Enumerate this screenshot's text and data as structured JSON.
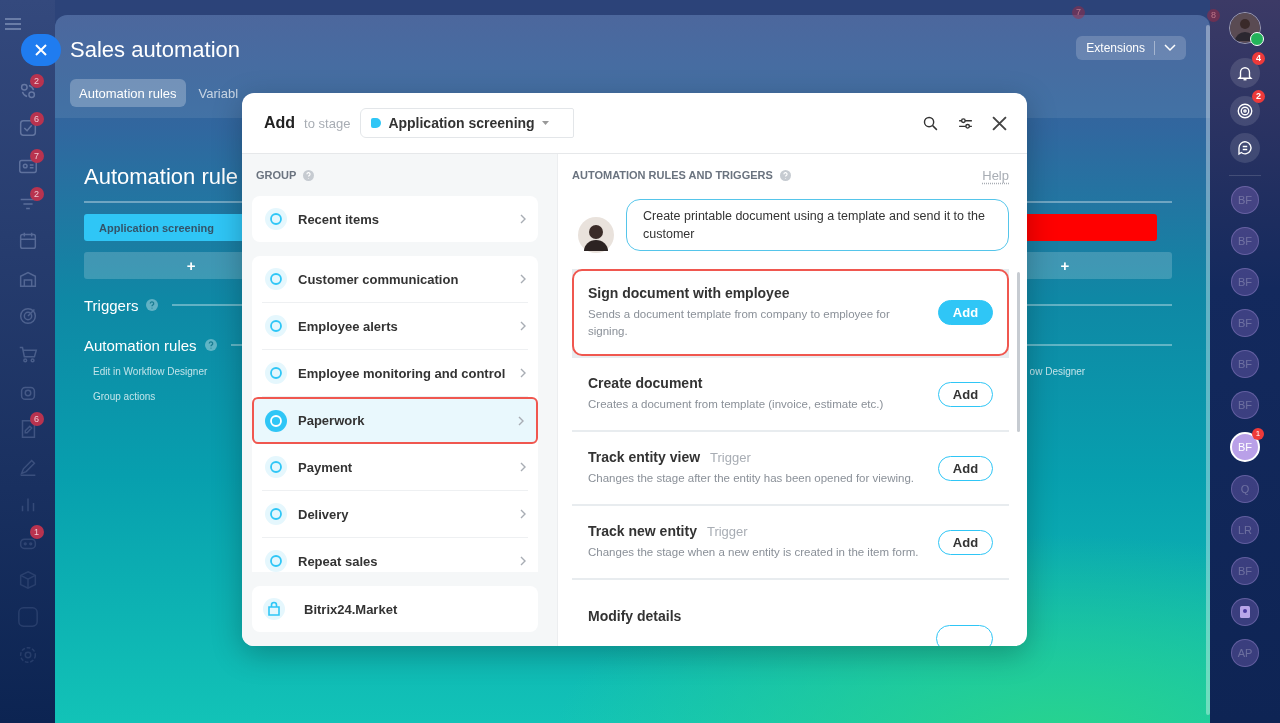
{
  "left_nav": {
    "items": [
      {
        "kind": "menu"
      },
      {
        "kind": "close"
      },
      {
        "kind": "link",
        "badge": "2"
      },
      {
        "kind": "link",
        "badge": "6"
      },
      {
        "kind": "link",
        "badge": "7"
      },
      {
        "kind": "link",
        "badge": "2"
      },
      {
        "kind": "link"
      },
      {
        "kind": "link"
      },
      {
        "kind": "link"
      },
      {
        "kind": "link"
      },
      {
        "kind": "link"
      },
      {
        "kind": "link",
        "badge": "6"
      },
      {
        "kind": "link"
      },
      {
        "kind": "link"
      },
      {
        "kind": "link",
        "badge": "1"
      },
      {
        "kind": "link"
      },
      {
        "kind": "link"
      },
      {
        "kind": "link"
      }
    ]
  },
  "background_badges": [
    "7",
    "8"
  ],
  "slider": {
    "title": "Sales automation",
    "extensions_button": "Extensions",
    "tabs": [
      {
        "label": "Automation rules",
        "selected": true
      },
      {
        "label": "Variabl",
        "selected": false
      }
    ]
  },
  "board": {
    "heading": "Automation rule",
    "stages": [
      {
        "label": "Application screening",
        "color": "#2fc6f6"
      },
      {
        "color": "#ff0000"
      }
    ],
    "add_buttons": [
      "+",
      "+"
    ],
    "sections": [
      {
        "title": "Triggers"
      },
      {
        "title": "Automation rules"
      }
    ],
    "links": [
      "Edit in Workflow Designer",
      "Group actions"
    ],
    "right_links": [
      "ow Designer"
    ]
  },
  "dialog": {
    "title": "Add",
    "subtitle": "to stage",
    "stage": {
      "label": "Application screening",
      "color": "#2fc6f6"
    },
    "group_heading": "GROUP",
    "group_sections": [
      {
        "items": [
          {
            "label": "Recent items",
            "selected": false
          }
        ]
      },
      {
        "items": [
          {
            "label": "Customer communication",
            "selected": false
          },
          {
            "label": "Employee alerts",
            "selected": false
          },
          {
            "label": "Employee monitoring and control",
            "selected": false
          },
          {
            "label": "Paperwork",
            "selected": true
          },
          {
            "label": "Payment",
            "selected": false
          },
          {
            "label": "Delivery",
            "selected": false
          },
          {
            "label": "Repeat sales",
            "selected": false
          }
        ]
      }
    ],
    "market": "Bitrix24.Market",
    "rules_heading": "AUTOMATION RULES AND TRIGGERS",
    "help": "Help",
    "hint": "Create printable document using a template and send it to the customer",
    "rules": [
      {
        "title": "Sign document with employee",
        "description": "Sends a document template from company to employee for signing.",
        "button": "Add",
        "selected": true
      },
      {
        "title": "Create document",
        "description": "Creates a document from template (invoice, estimate etc.)",
        "button": "Add",
        "selected": false
      },
      {
        "title": "Track entity view",
        "tag": "Trigger",
        "description": "Changes the stage after the entity has been opened for viewing.",
        "button": "Add",
        "selected": false
      },
      {
        "title": "Track new entity",
        "tag": "Trigger",
        "description": "Changes the stage when a new entity is created in the item form.",
        "button": "Add",
        "selected": false
      },
      {
        "title": "Modify details",
        "selected": false
      }
    ]
  },
  "right_bar": {
    "profile": {
      "online": true
    },
    "tools": [
      {
        "kind": "tool",
        "badge": "4"
      },
      {
        "kind": "tool",
        "badge": "2"
      },
      {
        "kind": "tool"
      }
    ],
    "contacts": [
      {
        "kind": "initials",
        "text": "BF",
        "selected": false
      },
      {
        "kind": "initials",
        "text": "BF",
        "selected": false
      },
      {
        "kind": "initials",
        "text": "BF",
        "selected": false
      },
      {
        "kind": "initials",
        "text": "BF",
        "selected": false
      },
      {
        "kind": "initials",
        "text": "BF",
        "selected": false
      },
      {
        "kind": "initials",
        "text": "BF",
        "selected": false
      },
      {
        "kind": "initials",
        "text": "BF",
        "selected": true,
        "badge": "1"
      },
      {
        "kind": "initials",
        "text": "Q",
        "selected": false
      },
      {
        "kind": "initials",
        "text": "LR",
        "selected": false
      },
      {
        "kind": "initials",
        "text": "BF",
        "selected": false
      },
      {
        "kind": "icon",
        "selected": false
      },
      {
        "kind": "initials",
        "text": "AP",
        "selected": false
      }
    ]
  }
}
